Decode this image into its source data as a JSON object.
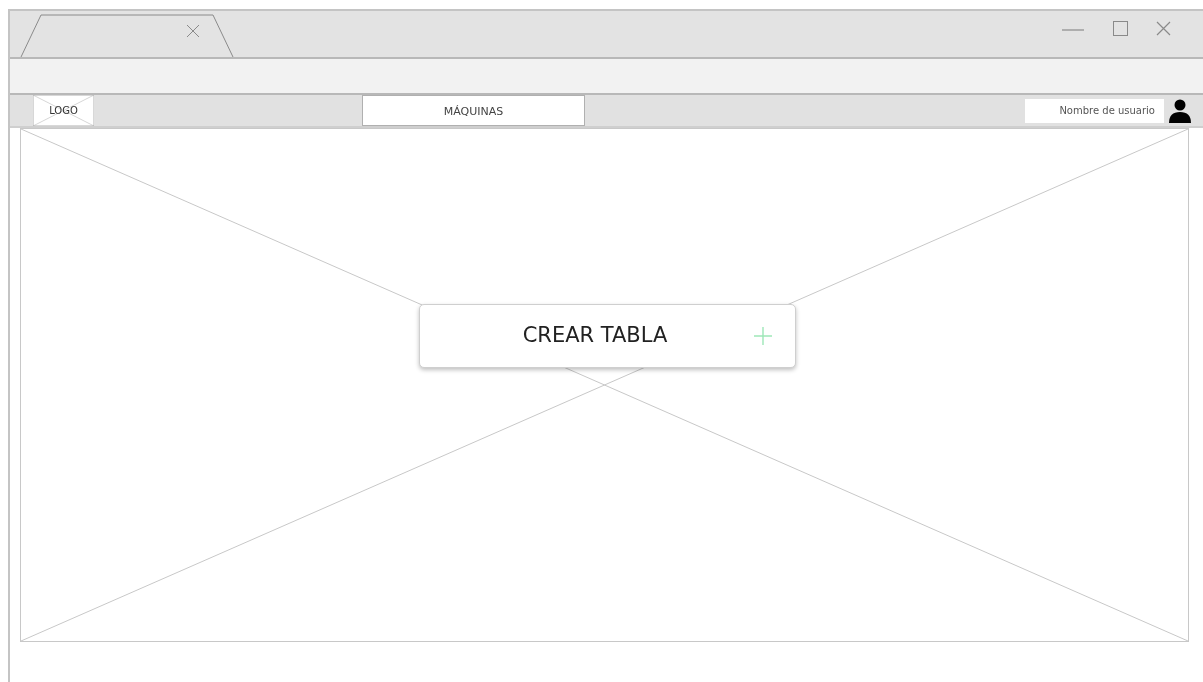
{
  "navbar": {
    "logo": "LOGO",
    "menu": [
      {
        "label": "MÁQUINAS"
      }
    ],
    "user": "Nombre de usuario"
  },
  "main": {
    "button": "CREAR TABLA"
  }
}
